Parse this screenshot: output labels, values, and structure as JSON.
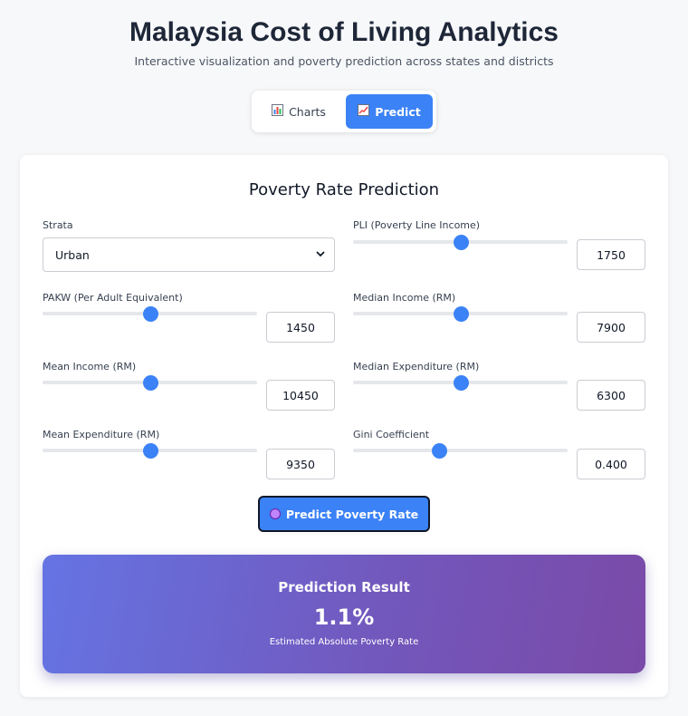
{
  "header": {
    "title": "Malaysia Cost of Living Analytics",
    "subtitle": "Interactive visualization and poverty prediction across states and districts"
  },
  "tabs": [
    {
      "label": "Charts",
      "icon": "bar-chart-icon",
      "active": false
    },
    {
      "label": "Predict",
      "icon": "trend-chart-icon",
      "active": true
    }
  ],
  "panel": {
    "title": "Poverty Rate Prediction",
    "strata": {
      "label": "Strata",
      "value": "Urban"
    },
    "fields": {
      "pli": {
        "label": "PLI (Poverty Line Income)",
        "value": "1750",
        "fraction": 0.5
      },
      "pakw": {
        "label": "PAKW (Per Adult Equivalent)",
        "value": "1450",
        "fraction": 0.5
      },
      "median_income": {
        "label": "Median Income (RM)",
        "value": "7900",
        "fraction": 0.5
      },
      "mean_income": {
        "label": "Mean Income (RM)",
        "value": "10450",
        "fraction": 0.5
      },
      "median_expenditure": {
        "label": "Median Expenditure (RM)",
        "value": "6300",
        "fraction": 0.5
      },
      "mean_expenditure": {
        "label": "Mean Expenditure (RM)",
        "value": "9350",
        "fraction": 0.5
      },
      "gini": {
        "label": "Gini Coefficient",
        "value": "0.400",
        "fraction": 0.4
      }
    },
    "predict_button": {
      "label": "Predict Poverty Rate",
      "icon": "brain-icon"
    }
  },
  "result": {
    "title": "Prediction Result",
    "value": "1.1%",
    "caption": "Estimated Absolute Poverty Rate"
  },
  "colors": {
    "accent": "#3b82f6",
    "title": "#1e2738",
    "gradient_start": "#6574e3",
    "gradient_end": "#7a4aa8"
  }
}
